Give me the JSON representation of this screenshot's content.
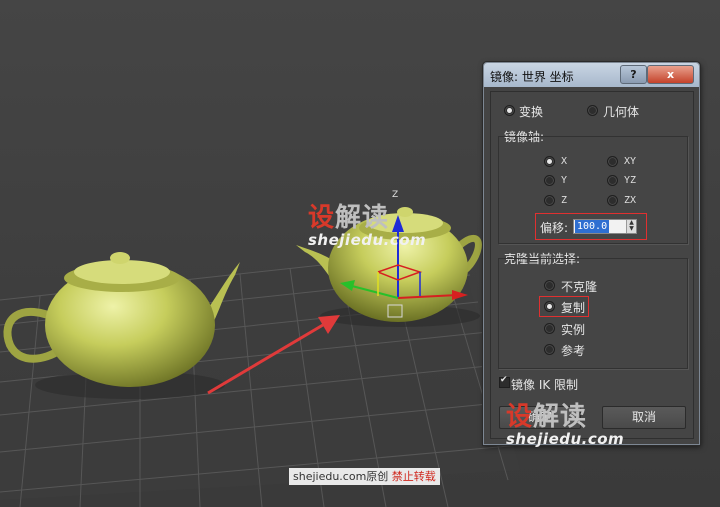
{
  "dialog": {
    "title": "镜像: 世界 坐标",
    "help_label": "?",
    "close_label": "x",
    "mode_options": [
      {
        "label": "变换",
        "selected": true
      },
      {
        "label": "几何体",
        "selected": false
      }
    ],
    "mirror_axis": {
      "label": "镜像轴:",
      "axes": [
        {
          "label": "X",
          "selected": true
        },
        {
          "label": "Y",
          "selected": false
        },
        {
          "label": "Z",
          "selected": false
        },
        {
          "label": "XY",
          "selected": false
        },
        {
          "label": "YZ",
          "selected": false
        },
        {
          "label": "ZX",
          "selected": false
        }
      ],
      "offset_label": "偏移:",
      "offset_value": "100.0"
    },
    "clone": {
      "label": "克隆当前选择:",
      "options": [
        {
          "label": "不克隆",
          "selected": false
        },
        {
          "label": "复制",
          "selected": true
        },
        {
          "label": "实例",
          "selected": false
        },
        {
          "label": "参考",
          "selected": false
        }
      ]
    },
    "ik_checkbox": {
      "label": "镜像 IK 限制",
      "checked": true
    },
    "ok_label": "确定",
    "cancel_label": "取消"
  },
  "viewport": {
    "gizmo_axis_label": "Z",
    "teapot_color": "#c7cf5f"
  },
  "watermark": {
    "logo_red": "设",
    "logo_gray": "解读",
    "url": "shejiedu.com"
  },
  "footer": {
    "site": "shejiedu.com",
    "original": "原创",
    "notice": "禁止转载"
  },
  "colors": {
    "highlight_red": "#e03030",
    "selection_blue": "#2f6fd1"
  }
}
